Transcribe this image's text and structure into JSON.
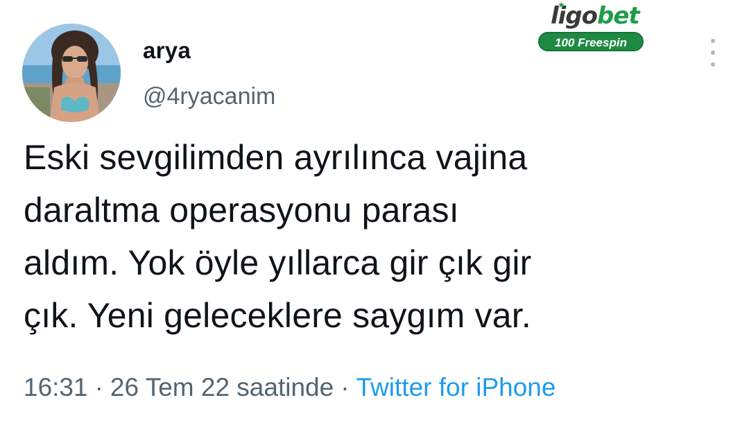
{
  "user": {
    "display_name": "arya",
    "handle": "@4ryacanim",
    "avatar": "avatar-photo"
  },
  "tweet": {
    "text": "Eski sevgilimden ayrılınca vajina\ndaraltma operasyonu parası\naldım. Yok öyle yıllarca gir çık gir\nçık. Yeni geleceklere saygım var.",
    "time": "16:31",
    "separator": "·",
    "date": "26 Tem 22 saatinde",
    "source": "Twitter for iPhone"
  },
  "watermark": {
    "logo_part1": "ligo",
    "logo_part2": "bet",
    "badge": "100 Freespin"
  },
  "icons": {
    "more": "more-vertical-icon"
  },
  "colors": {
    "text": "#0f1419",
    "muted": "#536471",
    "link": "#1d9bf0",
    "brand_green": "#1f9d4a"
  }
}
